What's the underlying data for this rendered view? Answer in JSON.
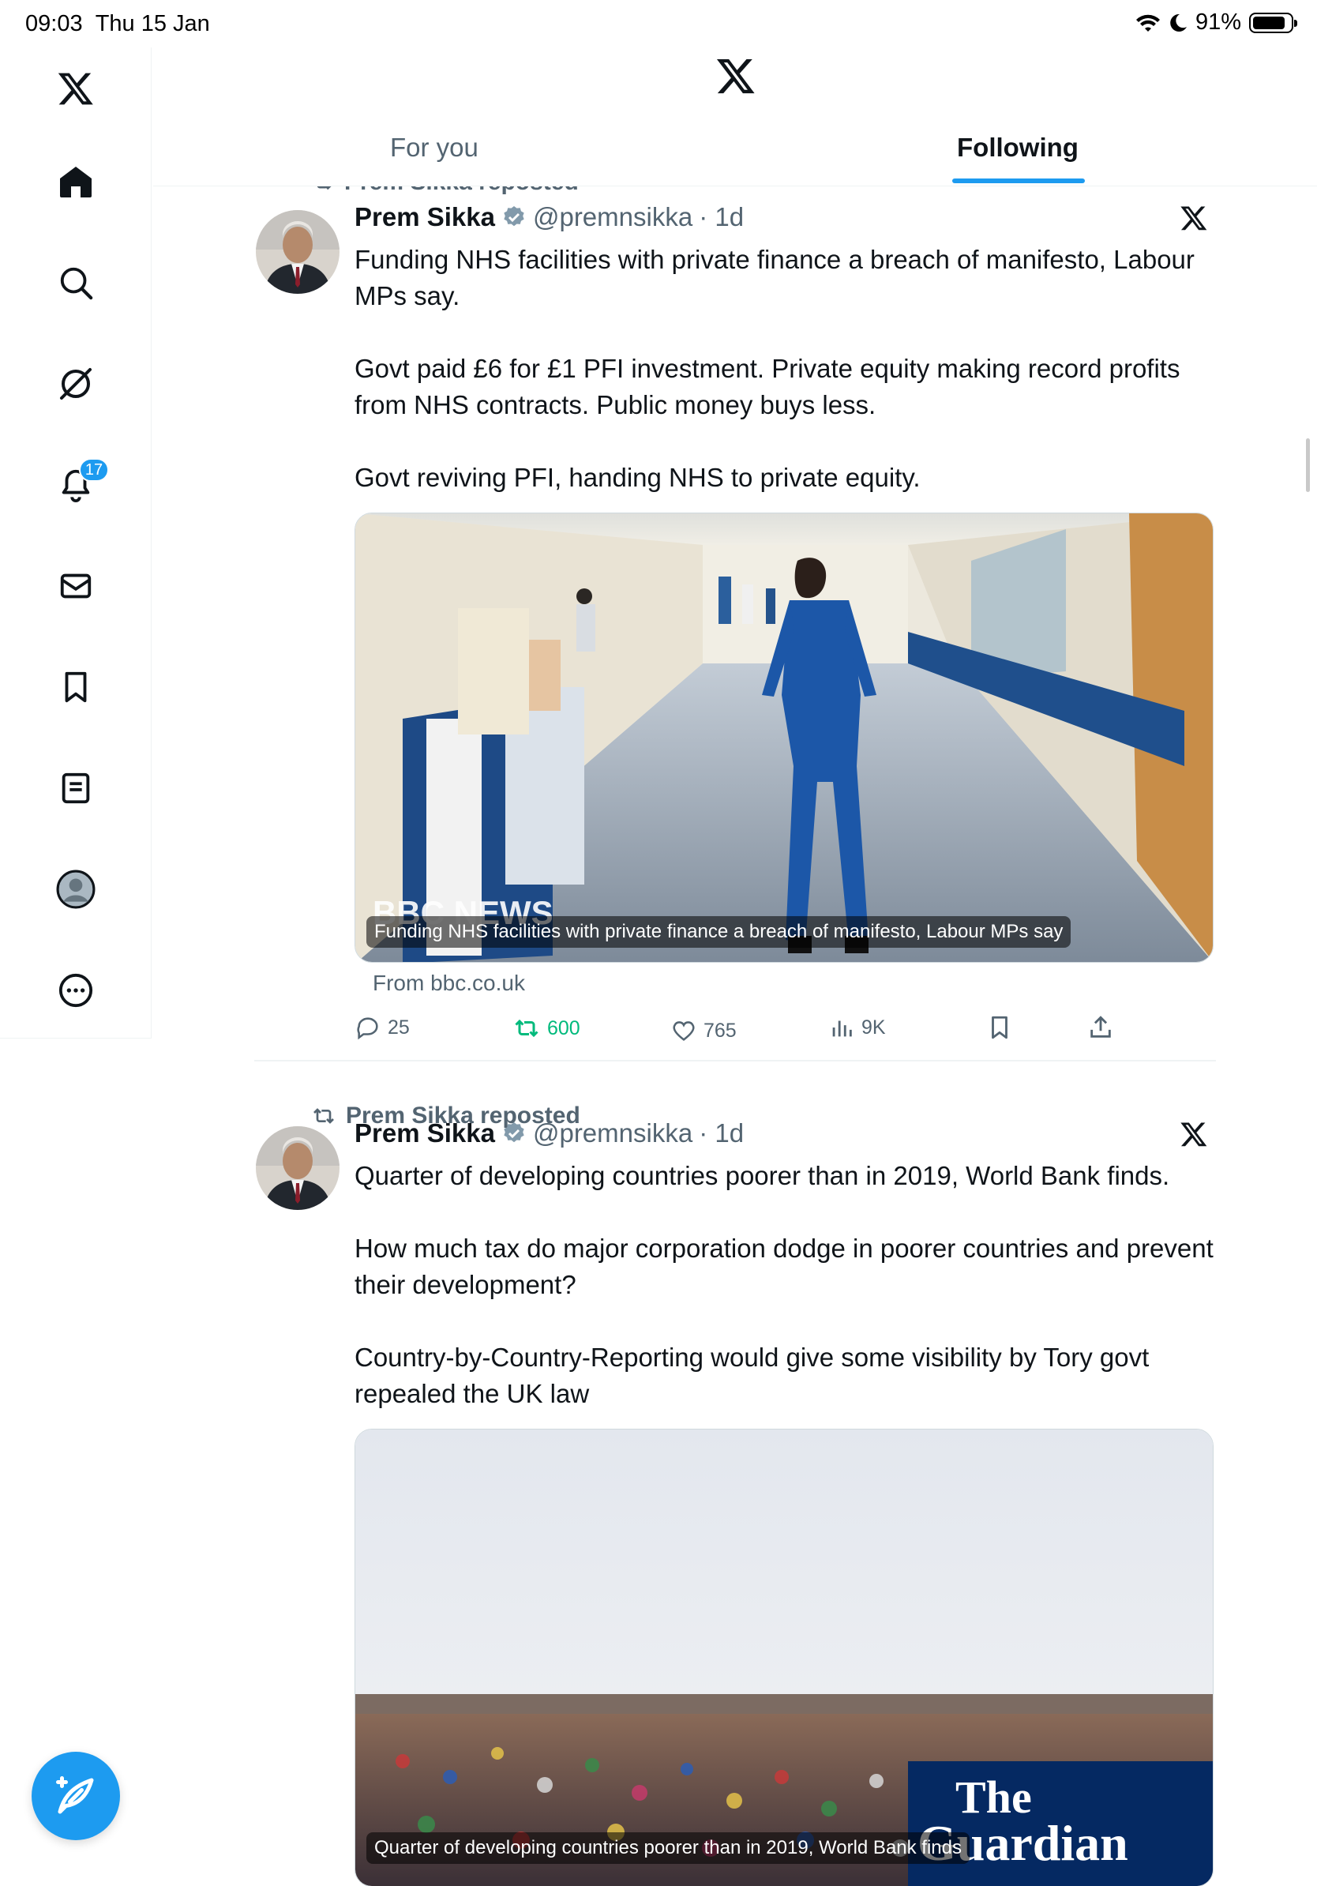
{
  "status_bar": {
    "time": "09:03",
    "date": "Thu 15 Jan",
    "battery": "91%"
  },
  "sidebar": {
    "items": [
      {
        "name": "logo",
        "icon": "x-logo-icon"
      },
      {
        "name": "home",
        "icon": "home-icon"
      },
      {
        "name": "explore",
        "icon": "search-icon"
      },
      {
        "name": "grok",
        "icon": "grok-icon"
      },
      {
        "name": "notifications",
        "icon": "bell-icon",
        "badge": "17"
      },
      {
        "name": "messages",
        "icon": "mail-icon"
      },
      {
        "name": "bookmarks",
        "icon": "bookmark-icon"
      },
      {
        "name": "lists",
        "icon": "list-icon"
      },
      {
        "name": "profile",
        "icon": "avatar-icon"
      },
      {
        "name": "more",
        "icon": "more-icon"
      }
    ],
    "compose_icon": "compose-icon"
  },
  "header": {
    "tabs": [
      {
        "label": "For you",
        "active": false
      },
      {
        "label": "Following",
        "active": true
      }
    ]
  },
  "colors": {
    "accent": "#1d9bf0",
    "retweet": "#00ba7c",
    "secondary_text": "#536471"
  },
  "tweets": [
    {
      "repost_label": "Prem Sikka reposted",
      "name": "Prem Sikka",
      "handle": "@premnsikka",
      "time": "· 1d",
      "text": [
        "Funding NHS facilities with private finance a breach of manifesto, Labour MPs say.",
        "Govt paid £6 for £1 PFI investment. Private equity making record profits from NHS contracts. Public money buys less.",
        "Govt reviving PFI, handing NHS to private equity."
      ],
      "card": {
        "overlay_logo": "BBC NEWS",
        "caption": "Funding NHS facilities with private finance a breach of manifesto, Labour MPs say",
        "from": "From bbc.co.uk"
      },
      "stats": {
        "replies": "25",
        "reposts": "600",
        "likes": "765",
        "views": "9K"
      }
    },
    {
      "repost_label": "Prem Sikka reposted",
      "name": "Prem Sikka",
      "handle": "@premnsikka",
      "time": "· 1d",
      "text": [
        "Quarter of developing countries poorer than in 2019, World Bank finds.",
        "How much tax do major corporation dodge in poorer countries and prevent their development?",
        "Country-by-Country-Reporting would give some visibility by Tory govt repealed the UK law"
      ],
      "card": {
        "overlay_logo_line1": "The",
        "overlay_logo_line2": "Guardian",
        "caption": "Quarter of developing countries poorer than in 2019, World Bank finds"
      }
    }
  ]
}
